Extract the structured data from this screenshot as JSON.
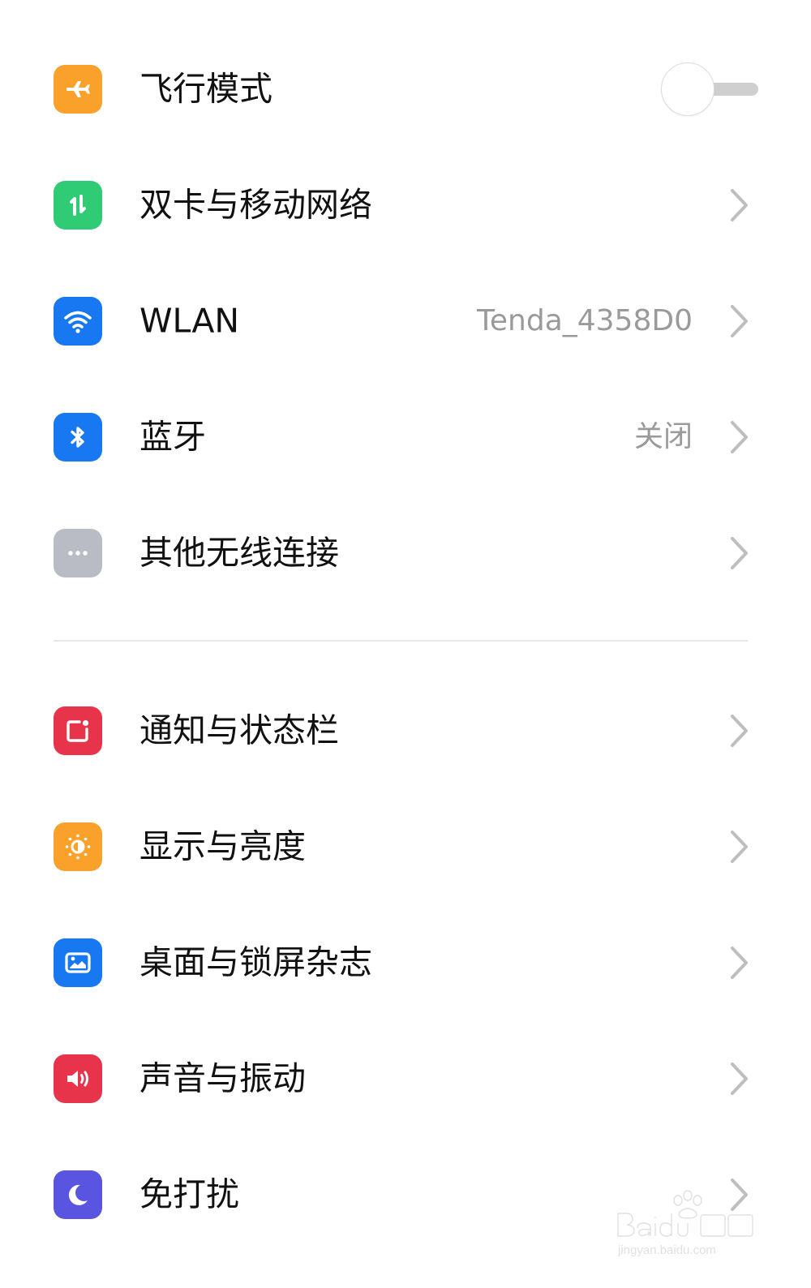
{
  "colors": {
    "orange": "#F9A12A",
    "green": "#2FCB75",
    "blue": "#1778F2",
    "gray": "#B9BCC4",
    "red": "#E8344A",
    "purple": "#5A55E0",
    "label": "#111111",
    "secondary": "#9A9A9A",
    "chevron": "#BEBEBE",
    "divider": "#E8E8E8"
  },
  "sections": [
    {
      "items": [
        {
          "label": "飞行模式",
          "icon": "airplane-icon",
          "icon_color": "#F9A12A",
          "control": "toggle",
          "toggle_on": false
        },
        {
          "label": "双卡与移动网络",
          "icon": "mobile-data-icon",
          "icon_color": "#2FCB75",
          "control": "chevron"
        },
        {
          "label": "WLAN",
          "icon": "wifi-icon",
          "icon_color": "#1778F2",
          "value": "Tenda_4358D0",
          "control": "chevron"
        },
        {
          "label": "蓝牙",
          "icon": "bluetooth-icon",
          "icon_color": "#1778F2",
          "value": "关闭",
          "control": "chevron"
        },
        {
          "label": "其他无线连接",
          "icon": "more-dots-icon",
          "icon_color": "#B9BCC4",
          "control": "chevron"
        }
      ]
    },
    {
      "items": [
        {
          "label": "通知与状态栏",
          "icon": "notification-icon",
          "icon_color": "#E8344A",
          "control": "chevron"
        },
        {
          "label": "显示与亮度",
          "icon": "brightness-icon",
          "icon_color": "#F9A12A",
          "control": "chevron"
        },
        {
          "label": "桌面与锁屏杂志",
          "icon": "wallpaper-icon",
          "icon_color": "#1778F2",
          "control": "chevron"
        },
        {
          "label": "声音与振动",
          "icon": "speaker-icon",
          "icon_color": "#E8344A",
          "control": "chevron"
        },
        {
          "label": "免打扰",
          "icon": "moon-icon",
          "icon_color": "#5A55E0",
          "control": "chevron"
        }
      ]
    }
  ],
  "watermark": {
    "brand": "Baidu经验",
    "url": "jingyan.baidu.com"
  }
}
